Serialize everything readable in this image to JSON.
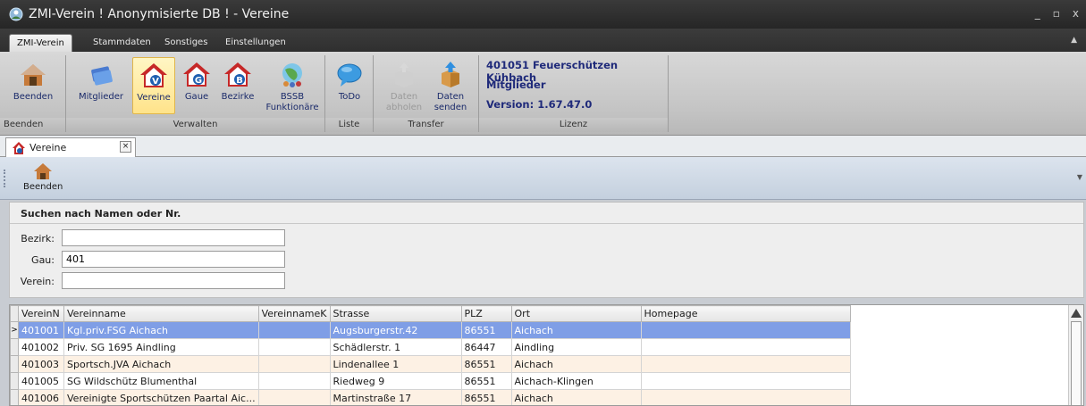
{
  "window": {
    "title": "ZMI-Verein  ! Anonymisierte DB !  - Vereine",
    "controls": [
      "_",
      "▫",
      "x"
    ]
  },
  "ribbon_tabs": [
    "ZMI-Verein",
    "Stammdaten",
    "Sonstiges",
    "Einstellungen"
  ],
  "ribbon": {
    "groups": {
      "beenden": "Beenden",
      "verwalten": "Verwalten",
      "liste": "Liste",
      "transfer": "Transfer",
      "lizenz": "Lizenz"
    },
    "buttons": {
      "beenden": "Beenden",
      "mitglieder": "Mitglieder",
      "vereine": "Vereine",
      "gaue": "Gaue",
      "bezirke": "Bezirke",
      "bssb_line1": "BSSB",
      "bssb_line2": "Funktionäre",
      "todo": "ToDo",
      "daten_abholen_line1": "Daten",
      "daten_abholen_line2": "abholen",
      "daten_senden_line1": "Daten",
      "daten_senden_line2": "senden"
    },
    "license": {
      "line1": "401051 Feuerschützen Kühbach",
      "line2": "Mitglieder",
      "line3": "Version: 1.67.47.0"
    }
  },
  "document_tab": {
    "label": "Vereine",
    "close": "×"
  },
  "toolbar": {
    "beenden": "Beenden"
  },
  "search": {
    "title": "Suchen nach Namen oder Nr.",
    "bezirk_label": "Bezirk:",
    "bezirk_value": "",
    "gau_label": "Gau:",
    "gau_value": "401",
    "verein_label": "Verein:",
    "verein_value": ""
  },
  "grid": {
    "columns": [
      "VereinN",
      "Vereinname",
      "VereinnameK",
      "Strasse",
      "PLZ",
      "Ort",
      "Homepage"
    ],
    "rows": [
      [
        "401001",
        "Kgl.priv.FSG Aichach",
        "",
        "Augsburgerstr.42",
        "86551",
        "Aichach",
        ""
      ],
      [
        "401002",
        "Priv. SG 1695 Aindling",
        "",
        "Schädlerstr. 1",
        "86447",
        "Aindling",
        ""
      ],
      [
        "401003",
        "Sportsch.JVA Aichach",
        "",
        "Lindenallee 1",
        "86551",
        "Aichach",
        ""
      ],
      [
        "401005",
        "SG Wildschütz Blumenthal",
        "",
        "Riedweg 9",
        "86551",
        "Aichach-Klingen",
        ""
      ],
      [
        "401006",
        "Vereinigte Sportschützen Paartal Aic...",
        "",
        "Martinstraße 17",
        "86551",
        "Aichach",
        ""
      ]
    ],
    "selected_row": 0,
    "row_indicator": ">"
  },
  "colors": {
    "selection": "#7f9ee6",
    "alt_row": "#fdf1e4",
    "license_text": "#1f2a7a"
  }
}
